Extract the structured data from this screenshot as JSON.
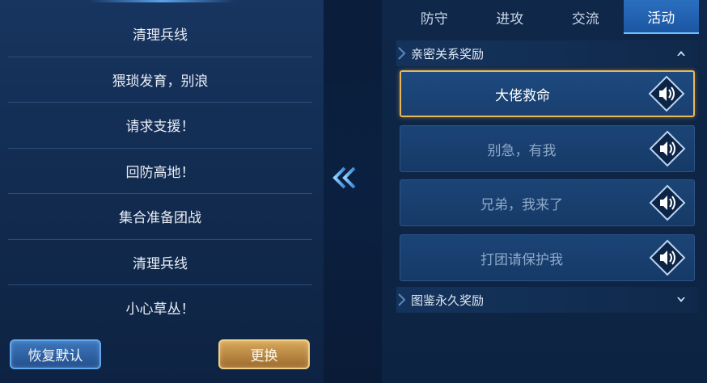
{
  "left": {
    "messages": [
      "清理兵线",
      "猥琐发育，别浪",
      "请求支援！",
      "回防高地！",
      "集合准备团战",
      "清理兵线",
      "小心草丛！"
    ],
    "restore_label": "恢复默认",
    "swap_label": "更换"
  },
  "tabs": [
    "防守",
    "进攻",
    "交流",
    "活动"
  ],
  "active_tab": "活动",
  "sections": {
    "intimacy_title": "亲密关系奖励",
    "intimacy_icon": "chevron-up-icon",
    "codex_title": "图鉴永久奖励",
    "codex_icon": "chevron-down-icon"
  },
  "voice_items": [
    {
      "label": "大佬救命",
      "selected": true
    },
    {
      "label": "别急，有我",
      "selected": false
    },
    {
      "label": "兄弟，我来了",
      "selected": false
    },
    {
      "label": "打团请保护我",
      "selected": false
    }
  ],
  "colors": {
    "accent_gold": "#e9b75a",
    "accent_blue": "#2a6fbf",
    "bg": "#0c1e3a"
  },
  "icons": {
    "swap_arrow": "double-chevron-left-icon",
    "speaker": "speaker-icon"
  }
}
